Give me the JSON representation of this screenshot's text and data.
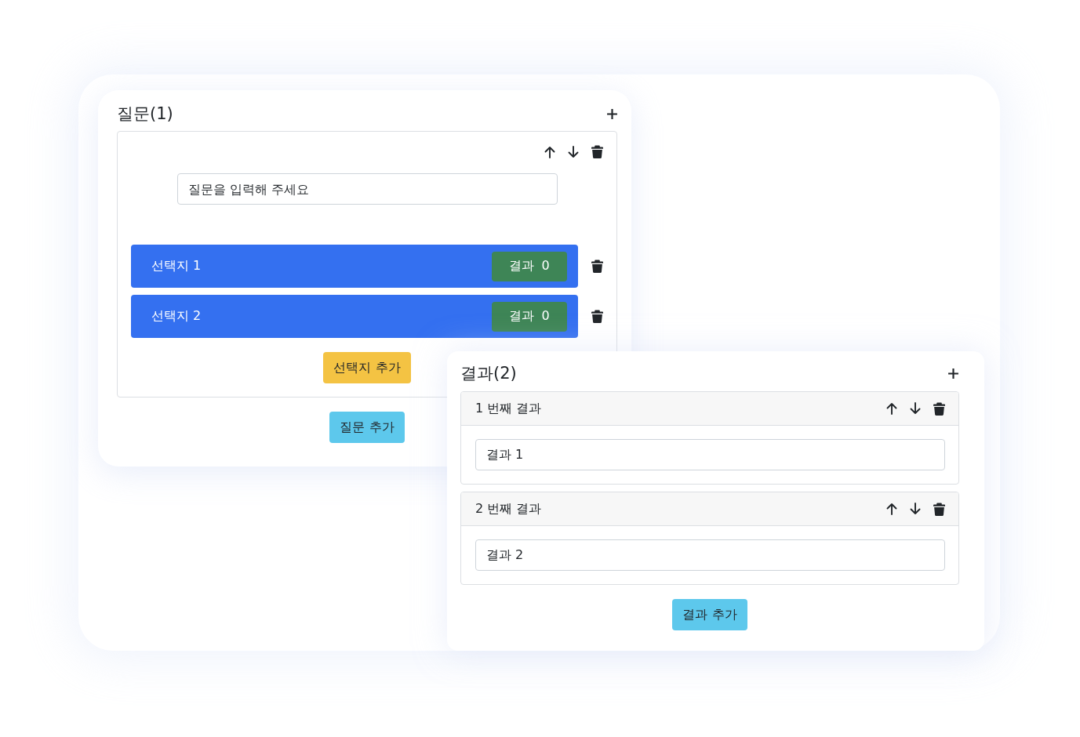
{
  "question_panel": {
    "title": "질문(1)",
    "questions": [
      {
        "placeholder": "질문을 입력해 주세요",
        "choices": [
          {
            "label": "선택지 1",
            "result_button": "결과 0"
          },
          {
            "label": "선택지 2",
            "result_button": "결과 0"
          }
        ],
        "add_choice_button": "선택지 추가"
      }
    ],
    "add_question_button": "질문 추가"
  },
  "result_panel": {
    "title": "결과(2)",
    "results": [
      {
        "heading": "1 번째 결과",
        "value": "결과 1"
      },
      {
        "heading": "2 번째 결과",
        "value": "결과 2"
      }
    ],
    "add_result_button": "결과 추가"
  }
}
